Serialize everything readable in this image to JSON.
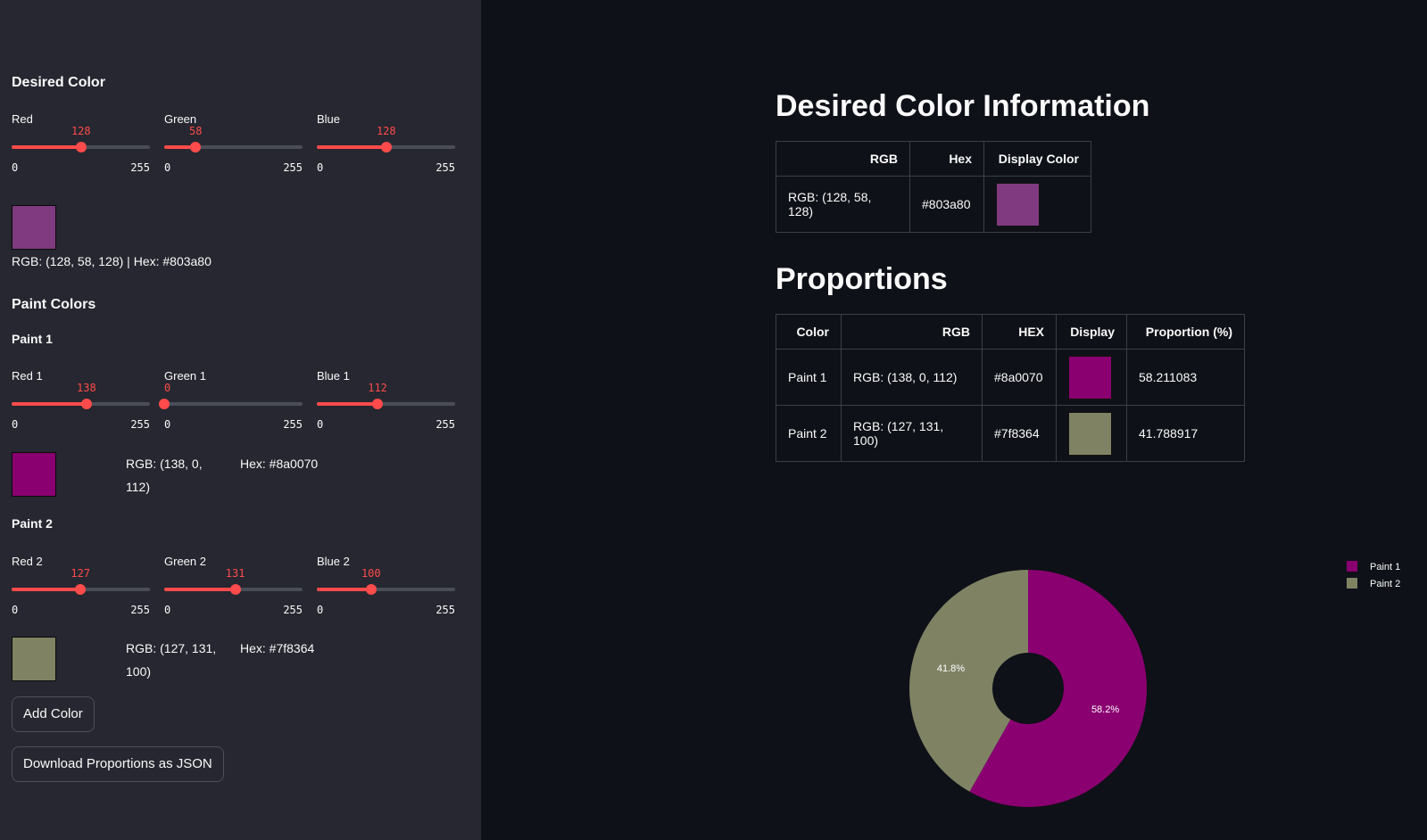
{
  "sidebar": {
    "desired_heading": "Desired Color",
    "desired_sliders": [
      {
        "label": "Red",
        "value": 128,
        "min": "0",
        "max": "255"
      },
      {
        "label": "Green",
        "value": 58,
        "min": "0",
        "max": "255"
      },
      {
        "label": "Blue",
        "value": 128,
        "min": "0",
        "max": "255"
      }
    ],
    "desired_color": "#803a80",
    "desired_text": "RGB: (128, 58, 128) | Hex: #803a80",
    "paint_colors_heading": "Paint Colors",
    "paints": [
      {
        "heading": "Paint 1",
        "sliders": [
          {
            "label": "Red 1",
            "value": 138,
            "min": "0",
            "max": "255"
          },
          {
            "label": "Green 1",
            "value": 0,
            "min": "0",
            "max": "255"
          },
          {
            "label": "Blue 1",
            "value": 112,
            "min": "0",
            "max": "255"
          }
        ],
        "color": "#8a0070",
        "rgb_text": "RGB: (138, 0, 112)",
        "hex_text": "Hex: #8a0070"
      },
      {
        "heading": "Paint 2",
        "sliders": [
          {
            "label": "Red 2",
            "value": 127,
            "min": "0",
            "max": "255"
          },
          {
            "label": "Green 2",
            "value": 131,
            "min": "0",
            "max": "255"
          },
          {
            "label": "Blue 2",
            "value": 100,
            "min": "0",
            "max": "255"
          }
        ],
        "color": "#7f8364",
        "rgb_text": "RGB: (127, 131, 100)",
        "hex_text": "Hex: #7f8364"
      }
    ],
    "add_color_label": "Add Color",
    "download_label": "Download Proportions as JSON"
  },
  "main": {
    "desired_title": "Desired Color Information",
    "desired_table": {
      "headers": [
        "RGB",
        "Hex",
        "Display Color"
      ],
      "row": {
        "rgb": "RGB: (128, 58, 128)",
        "hex": "#803a80",
        "color": "#803a80"
      }
    },
    "proportions_title": "Proportions",
    "proportions_table": {
      "headers": [
        "Color",
        "RGB",
        "HEX",
        "Display",
        "Proportion (%)"
      ],
      "rows": [
        {
          "name": "Paint 1",
          "rgb": "RGB: (138, 0, 112)",
          "hex": "#8a0070",
          "color": "#8a0070",
          "proportion": "58.211083"
        },
        {
          "name": "Paint 2",
          "rgb": "RGB: (127, 131, 100)",
          "hex": "#7f8364",
          "color": "#7f8364",
          "proportion": "41.788917"
        }
      ]
    }
  },
  "chart_data": {
    "type": "pie",
    "hole": true,
    "categories": [
      "Paint 1",
      "Paint 2"
    ],
    "values": [
      58.2,
      41.8
    ],
    "labels": [
      "58.2%",
      "41.8%"
    ],
    "colors": [
      "#8a0070",
      "#7f8364"
    ],
    "legend": "top-right"
  },
  "colors": {
    "accent": "#ff4b4b",
    "sidebar_bg": "#262730",
    "main_bg": "#0e1117"
  }
}
